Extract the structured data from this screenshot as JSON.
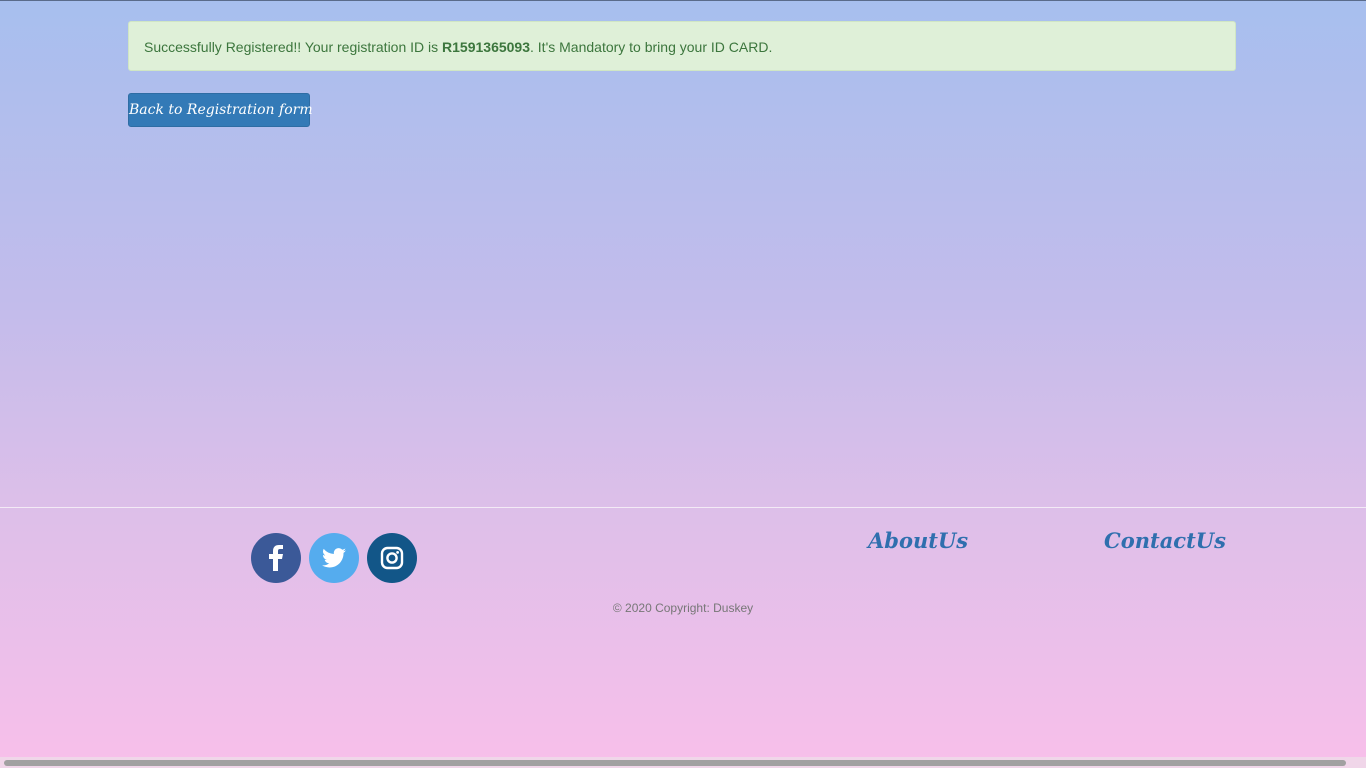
{
  "alert": {
    "prefix": "Successfully Registered!! Your registration ID is ",
    "registration_id": "R1591365093",
    "suffix": ". It's Mandatory to bring your ID CARD."
  },
  "actions": {
    "back_label": "Back to Registration form"
  },
  "footer": {
    "social": [
      {
        "icon": "facebook-icon",
        "color": "#3b5998"
      },
      {
        "icon": "twitter-icon",
        "color": "#55acee"
      },
      {
        "icon": "instagram-icon",
        "color": "#125688"
      }
    ],
    "about_label": "AboutUs",
    "contact_label": "ContactUs",
    "copyright": "© 2020 Copyright: Duskey"
  }
}
